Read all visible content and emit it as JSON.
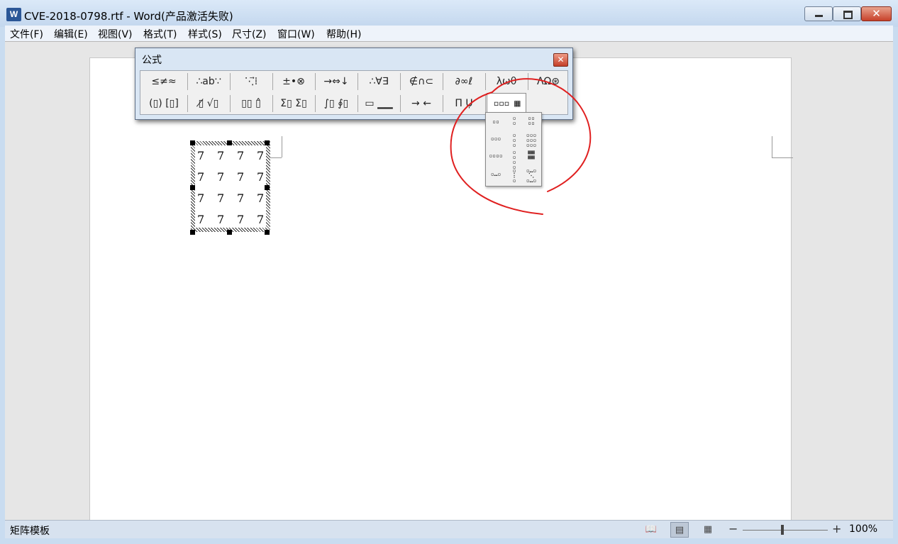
{
  "window": {
    "title": "CVE-2018-0798.rtf - Word(产品激活失败)",
    "app_icon": "word-doc-icon",
    "controls": {
      "minimize_icon": "minimize-icon",
      "maximize_icon": "maximize-icon",
      "close_icon": "close-icon",
      "close_glyph": "✕"
    }
  },
  "menu": [
    "文件(F)",
    "编辑(E)",
    "视图(V)",
    "格式(T)",
    "样式(S)",
    "尺寸(Z)",
    "窗口(W)",
    "帮助(H)"
  ],
  "matrix": {
    "cells": [
      [
        "7",
        "7",
        "7",
        "7"
      ],
      [
        "7",
        "7",
        "7",
        "7"
      ],
      [
        "7",
        "7",
        "7",
        "7"
      ],
      [
        "7",
        "7",
        "7",
        "7"
      ]
    ]
  },
  "equation_palette": {
    "title": "公式",
    "close_glyph": "✕",
    "row1": [
      "≤≠≈",
      "∴ab∵",
      "⋱⃗⁞",
      "±•⊗",
      "→⇔↓",
      "∴∀∃",
      "∉∩⊂",
      "∂∞ℓ",
      "λωθ",
      "ΛΩ⊛"
    ],
    "row2": [
      "(▯) [▯]",
      "▯̸ √▯",
      "▯▯ ▯̂",
      "Σ▯ Σ▯",
      "∫▯ ∮▯",
      "▭ ▁▁",
      "→ ←",
      "Π̄ Ụ",
      "▫▫▫ ▦"
    ],
    "selected_button": "matrix-templates"
  },
  "matrix_dropdown": {
    "items": [
      "▫▫",
      "▫\n▫",
      "▫▫\n▫▫",
      "▫▫▫",
      "▫\n▫\n▫",
      "▫▫▫\n▫▫▫\n▫▫▫",
      "▫▫▫▫",
      "▫\n▫\n▫\n▫",
      "▦▦\n▦▦",
      "▫…▫",
      "▫\n⋮\n▫",
      "▫…▫\n⋱\n▫…▫"
    ]
  },
  "annotation": {
    "color": "#e02020",
    "shape": "freehand-circle"
  },
  "statusbar": {
    "text": "矩阵模板",
    "zoom": "100%",
    "zoom_minus": "−",
    "zoom_plus": "+",
    "view_icons": [
      "reading-view-icon",
      "print-layout-icon",
      "web-layout-icon"
    ],
    "view_glyphs": [
      "📖",
      "▤",
      "▦"
    ]
  },
  "colors": {
    "titlebar": "#c3d7ee",
    "menubar": "#eef3fa",
    "statusbar": "#d7e2ef",
    "close_button": "#c7412a"
  }
}
